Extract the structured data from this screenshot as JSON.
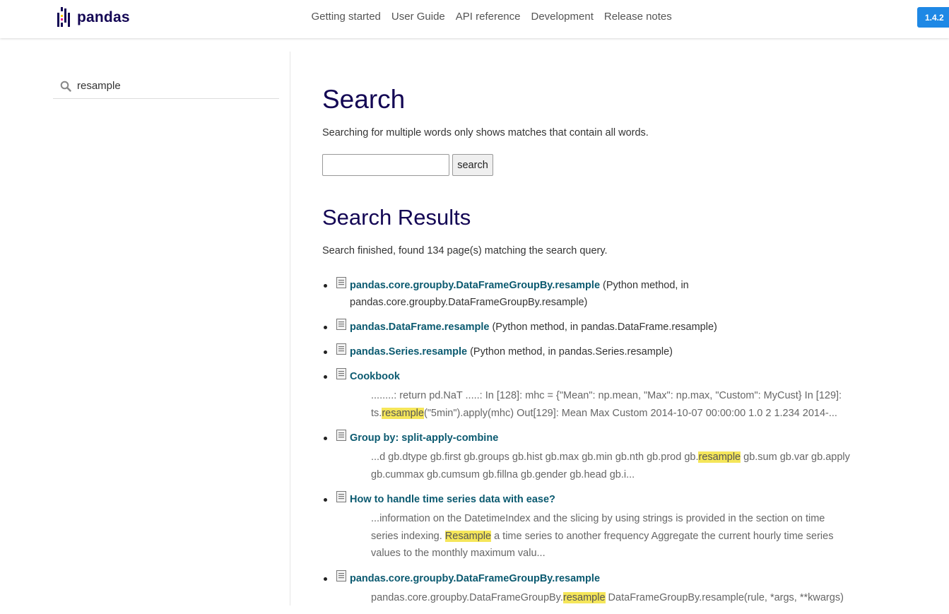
{
  "brand": {
    "name": "pandas",
    "colors": [
      "#130654",
      "#ffca00",
      "#e70488"
    ]
  },
  "nav": {
    "links": [
      "Getting started",
      "User Guide",
      "API reference",
      "Development",
      "Release notes"
    ],
    "version": "1.4.2"
  },
  "sidebar": {
    "search_value": "resample",
    "search_icon": "search-icon"
  },
  "main": {
    "title": "Search",
    "intro": "Searching for multiple words only shows matches that contain all words.",
    "search_button": "search",
    "search_input_value": "",
    "results_title": "Search Results",
    "status": "Search finished, found 134 page(s) matching the search query.",
    "results": [
      {
        "title": "pandas.core.groupby.DataFrameGroupBy.resample",
        "meta": " (Python method, in pandas.core.groupby.DataFrameGroupBy.resample)"
      },
      {
        "title": "pandas.DataFrame.resample",
        "meta": " (Python method, in pandas.DataFrame.resample)"
      },
      {
        "title": "pandas.Series.resample",
        "meta": " (Python method, in pandas.Series.resample)"
      },
      {
        "title": "Cookbook",
        "ctx_before": "........: return pd.NaT .....: In [128]: mhc = {\"Mean\": np.mean, \"Max\": np.max, \"Custom\": MyCust} In [129]: ts.",
        "ctx_hl": "resample",
        "ctx_after": "(\"5min\").apply(mhc) Out[129]: Mean Max Custom 2014-10-07 00:00:00 1.0 2 1.234 2014-..."
      },
      {
        "title": "Group by: split-apply-combine",
        "ctx_before": "...d gb.dtype gb.first gb.groups gb.hist gb.max gb.min gb.nth gb.prod gb.",
        "ctx_hl": "resample",
        "ctx_after": " gb.sum gb.var gb.apply gb.cummax gb.cumsum gb.fillna gb.gender gb.head gb.i..."
      },
      {
        "title": "How to handle time series data with ease?",
        "ctx_before": "...information on the DatetimeIndex and the slicing by using strings is provided in the section on time series indexing. ",
        "ctx_hl": "Resample",
        "ctx_after": " a time series to another frequency Aggregate the current hourly time series values to the monthly maximum valu..."
      },
      {
        "title": "pandas.core.groupby.DataFrameGroupBy.resample",
        "ctx_before": "pandas.core.groupby.DataFrameGroupBy.",
        "ctx_hl": "resample",
        "ctx_after": " DataFrameGroupBy.resample(rule, *args, **kwargs)"
      }
    ]
  }
}
